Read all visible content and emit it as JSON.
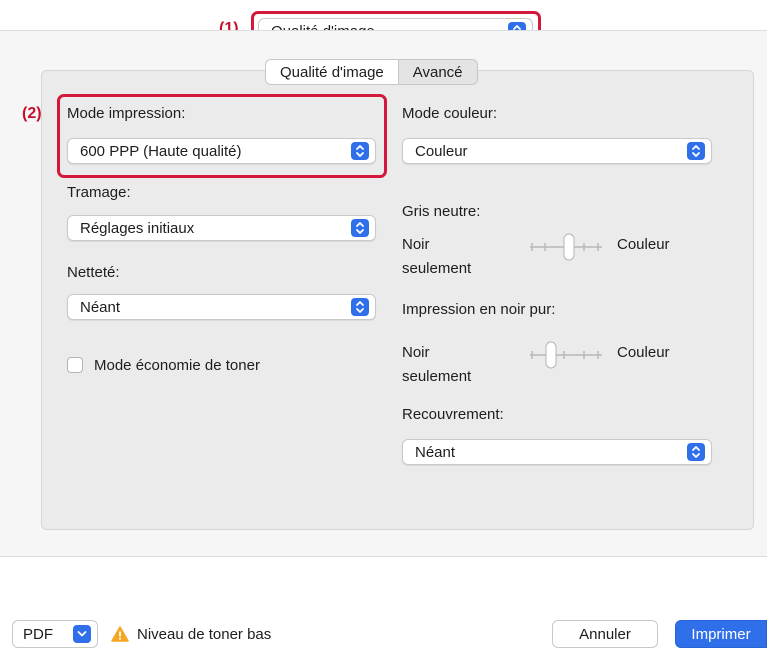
{
  "header": {
    "callout1": "(1)",
    "preset_popup": "Qualité d'image"
  },
  "tabs": [
    {
      "label": "Qualité d'image",
      "active": true
    },
    {
      "label": "Avancé",
      "active": false
    }
  ],
  "left": {
    "callout2": "(2)",
    "print_mode": {
      "label": "Mode impression:",
      "value": "600 PPP (Haute qualité)"
    },
    "screening": {
      "label": "Tramage:",
      "value": "Réglages initiaux"
    },
    "sharpness": {
      "label": "Netteté:",
      "value": "Néant"
    },
    "toner_save": {
      "label": "Mode économie de toner",
      "checked": false
    }
  },
  "right": {
    "color_mode": {
      "label": "Mode couleur:",
      "value": "Couleur"
    },
    "neutral_gray": {
      "label": "Gris neutre:",
      "left_label_1": "Noir",
      "left_label_2": "seulement",
      "right_label": "Couleur"
    },
    "pure_black": {
      "label": "Impression en noir pur:",
      "left_label_1": "Noir",
      "left_label_2": "seulement",
      "right_label": "Couleur"
    },
    "overprint": {
      "label": "Recouvrement:",
      "value": "Néant"
    }
  },
  "footer": {
    "pdf_label": "PDF",
    "warning_text": "Niveau de toner bas",
    "cancel_label": "Annuler",
    "print_label": "Imprimer"
  },
  "colors": {
    "accent": "#2f6fea",
    "highlight": "#d3183c",
    "warning": "#f5a623"
  }
}
